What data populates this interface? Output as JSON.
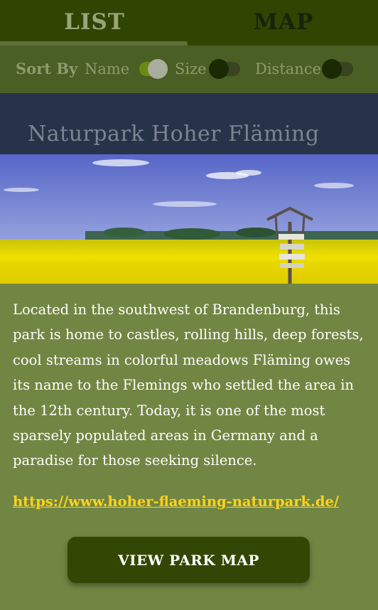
{
  "tabs": [
    {
      "label": "LIST",
      "active": true
    },
    {
      "label": "MAP",
      "active": false
    }
  ],
  "sort": {
    "title": "Sort By",
    "options": [
      {
        "label": "Name",
        "on": true
      },
      {
        "label": "Size",
        "on": false
      },
      {
        "label": "Distance",
        "on": false
      }
    ]
  },
  "park": {
    "title": "Naturpark Hoher Fläming",
    "description": "Located in the southwest of Brandenburg, this park is home to castles, rolling hills, deep forests, cool streams in colorful meadows Fläming owes its name to the Flemings who settled the area in the 12th century. Today, it is one of the most sparsely populated areas in Germany and a paradise for those seeking silence.",
    "link": "https://www.hoher-flaeming-naturpark.de/",
    "button_label": "VIEW PARK MAP"
  },
  "colors": {
    "accent": "#314503",
    "link": "#ffd21a",
    "background": "#728643"
  }
}
